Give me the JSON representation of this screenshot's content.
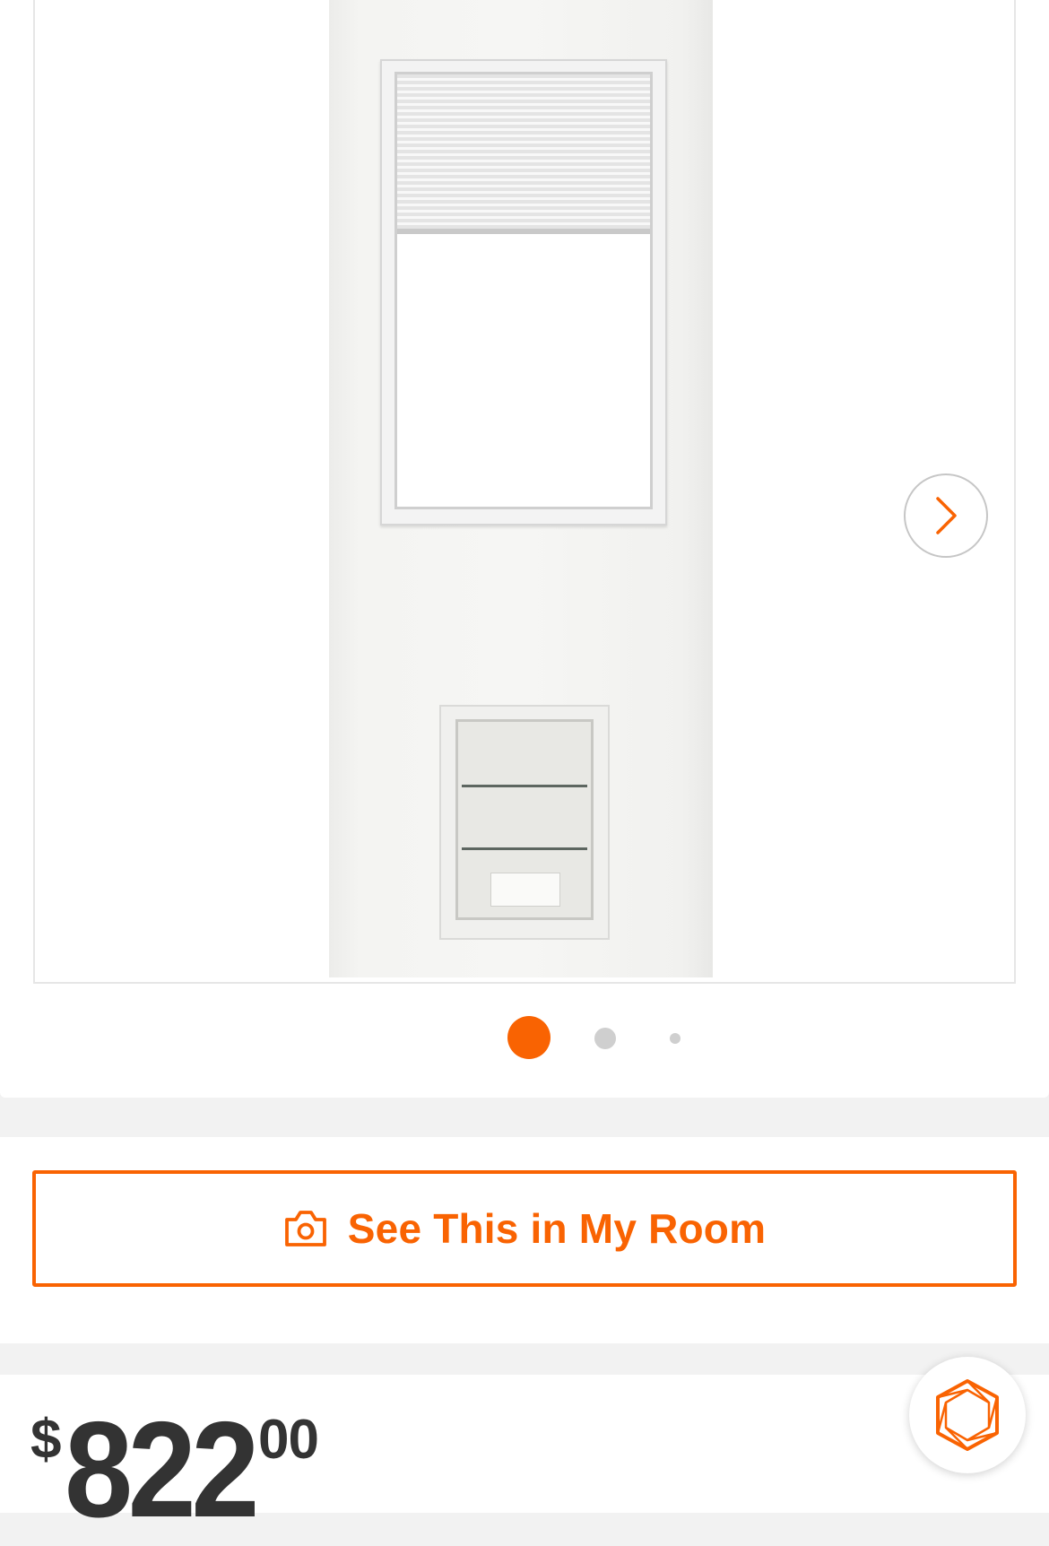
{
  "gallery": {
    "image_alt": "",
    "next_icon": "chevron-right-icon",
    "dot_count": 3,
    "active_index": 0
  },
  "ar_button": {
    "icon": "camera-icon",
    "label": "See This in My Room"
  },
  "price": {
    "currency": "$",
    "dollars": "822",
    "cents": "00"
  },
  "chat": {
    "icon": "hexagon-chat-icon"
  },
  "colors": {
    "accent": "#f96302",
    "text": "#333333",
    "divider": "#f2f2f2"
  }
}
